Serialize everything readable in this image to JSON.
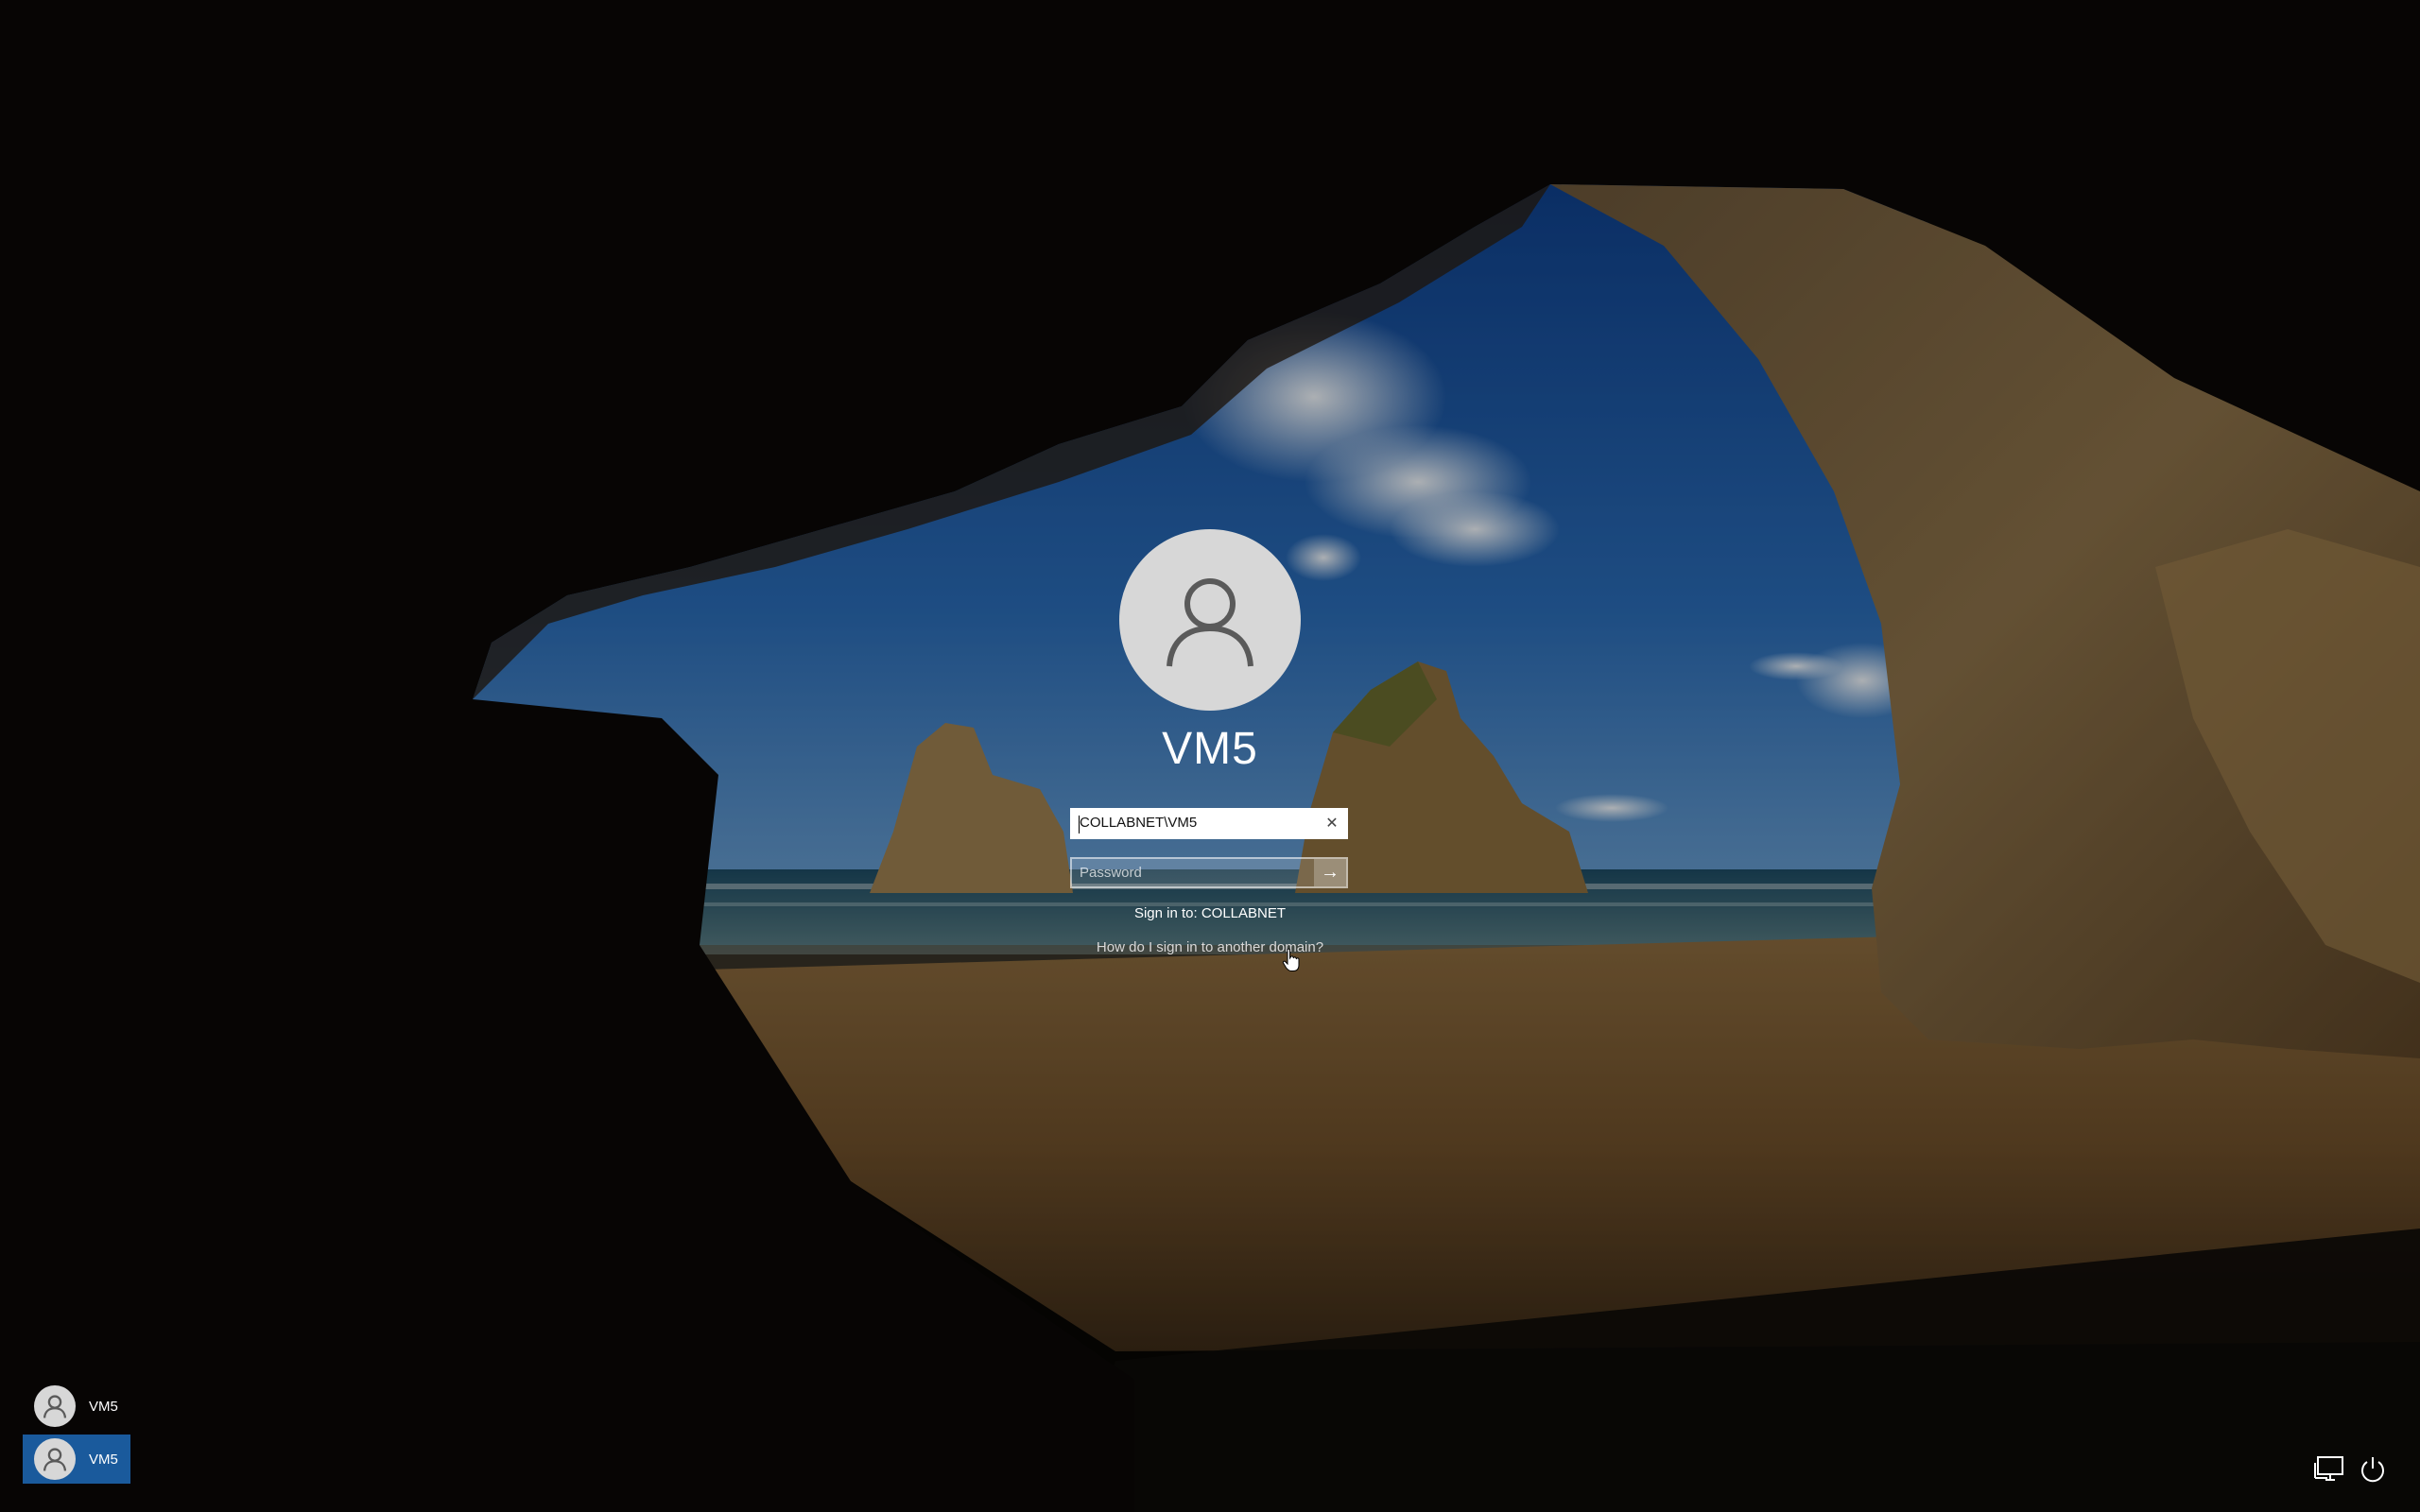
{
  "login": {
    "display_name": "VM5",
    "username_value": "COLLABNET\\VM5",
    "password_placeholder": "Password",
    "sign_in_to": "Sign in to: COLLABNET",
    "other_domain_link": "How do I sign in to another domain?"
  },
  "user_list": [
    {
      "label": "VM5",
      "selected": false
    },
    {
      "label": "VM5",
      "selected": true
    }
  ],
  "icons": {
    "clear": "close-icon",
    "submit": "arrow-right-icon",
    "network": "network-icon",
    "power": "power-icon"
  },
  "colors": {
    "selected_tile": "#1a5a9c",
    "avatar_bg": "#d7d7d7",
    "avatar_fg": "#5a5a5a"
  }
}
